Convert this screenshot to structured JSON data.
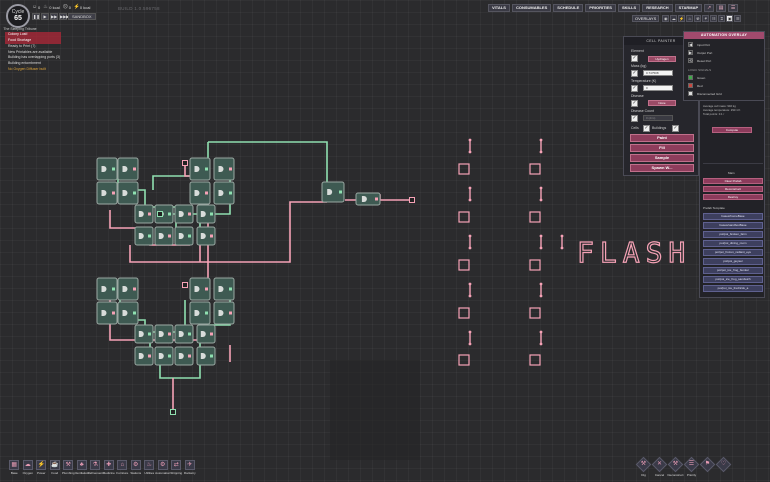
{
  "colony": {
    "cycle_label": "Cycle",
    "cycle_number": "65",
    "name": "The Sleeping Tribune"
  },
  "stats": {
    "duplicants": "0",
    "calories": "0 kcal",
    "stress": "0",
    "power": "0 kcal"
  },
  "speed": {
    "buttons": [
      "❚❚",
      "▶",
      "▶▶",
      "▶▶▶"
    ],
    "sandbox_label": "SANDBOX"
  },
  "build_label": "BUILD 1.0.596758",
  "notifications": [
    {
      "text": "Colony Lost!",
      "kind": "bad"
    },
    {
      "text": "Food Shortage",
      "kind": "bad"
    },
    {
      "text": "Ready to Print (7)",
      "kind": "info"
    },
    {
      "text": "New Printables are available",
      "kind": "info"
    },
    {
      "text": "Building has overlapping ports (3)",
      "kind": "info"
    },
    {
      "text": "Building entombment",
      "kind": "info"
    },
    {
      "text": "No Oxygen Diffuser built",
      "kind": "warn"
    }
  ],
  "toolbar": {
    "buttons": [
      "VITALS",
      "CONSUMABLES",
      "SCHEDULE",
      "PRIORITIES",
      "SKILLS",
      "RESEARCH",
      "STARMAP"
    ],
    "overlays_label": "OVERLAYS",
    "overlay_icons": [
      "◉",
      "☁",
      "⚡",
      "♨",
      "☢",
      "⚘",
      "☷",
      "⌗",
      "▣",
      "☰"
    ]
  },
  "cell_painter": {
    "title": "CELL PAINTER",
    "element_label": "Element",
    "element_value": "Hydrogen",
    "mass_label": "Mass (kg)",
    "mass_value": "0.747508",
    "temperature_label": "Temperature (K)",
    "temperature_value": "0",
    "disease_label": "Disease",
    "disease_value": "None",
    "disease_count_label": "Disease Count",
    "disease_count_value": "0 (dim)",
    "cells_label": "Cells",
    "buildings_label": "Buildings",
    "actions": [
      "Paint",
      "Fill",
      "Sample",
      "Spawn W..."
    ]
  },
  "footprint": {
    "title": "AUTOMATION OVERLAY",
    "legend": [
      {
        "label": "Input Port",
        "color": "#2e2e33"
      },
      {
        "label": "Output Port",
        "color": "#2e2e33"
      },
      {
        "label": "Reset Port",
        "color": "#2e2e33"
      }
    ],
    "sub_label": "LOGIC SIGNALS",
    "signals": [
      {
        "label": "Green",
        "color": "#3fa84a"
      },
      {
        "label": "Red",
        "color": "#c8473f"
      },
      {
        "label": "Disconnected Grid",
        "color": "#dcdcdc"
      }
    ]
  },
  "side_panel": {
    "info_lines": [
      "Average cell mass: 940 kg",
      "Average temperature: 293.1 K",
      "Total points: 0.1 /"
    ],
    "refresh_label": "Compute",
    "menu_head": "Main",
    "menu_buttons": [
      "Clear Prefab",
      "Reconstruct",
      "Destroy"
    ],
    "prefab_head": "Prefab Template",
    "prefabs": [
      "bases/homeBase",
      "bases/sandboxBase",
      "poi/poi_broken_farm",
      "poi/poi_dining_room",
      "poi/poi_frozen_radiant_eye",
      "poi/poi_geyser",
      "poi/poi_ice_frog_bunker",
      "poi/poi_ice_frog_sandwich",
      "poi/poi_ice_fredricsk_a"
    ]
  },
  "build_menu": [
    {
      "label": "Base",
      "icon": "▦"
    },
    {
      "label": "Oxygen",
      "icon": "☁"
    },
    {
      "label": "Power",
      "icon": "⚡"
    },
    {
      "label": "Food",
      "icon": "☕"
    },
    {
      "label": "Plumbing",
      "icon": "⚒"
    },
    {
      "label": "Ventilation",
      "icon": "♣"
    },
    {
      "label": "Refinement",
      "icon": "⚗"
    },
    {
      "label": "Medicine",
      "icon": "✚"
    },
    {
      "label": "Furniture",
      "icon": "⌂"
    },
    {
      "label": "Stations",
      "icon": "⚙"
    },
    {
      "label": "Utilities",
      "icon": "♨"
    },
    {
      "label": "Automation",
      "icon": "⚙"
    },
    {
      "label": "Shipping",
      "icon": "⇄"
    },
    {
      "label": "Rocketry",
      "icon": "✈"
    }
  ],
  "tools": [
    {
      "label": "Dig",
      "icon": "⚒"
    },
    {
      "label": "Cancel",
      "icon": "✕"
    },
    {
      "label": "Deconstruct",
      "icon": "⚒"
    },
    {
      "label": "Priority",
      "icon": "☰"
    },
    {
      "label": "",
      "icon": "⚑"
    },
    {
      "label": "",
      "icon": "♡"
    }
  ],
  "world_sign_text": "FLASH",
  "colors": {
    "wire_red": "#f6a2b6",
    "wire_green": "#8fe0b0",
    "gate_fill": "#3e5a52",
    "gate_border": "#9aa8a2",
    "accent_pink": "#a14a6d"
  }
}
